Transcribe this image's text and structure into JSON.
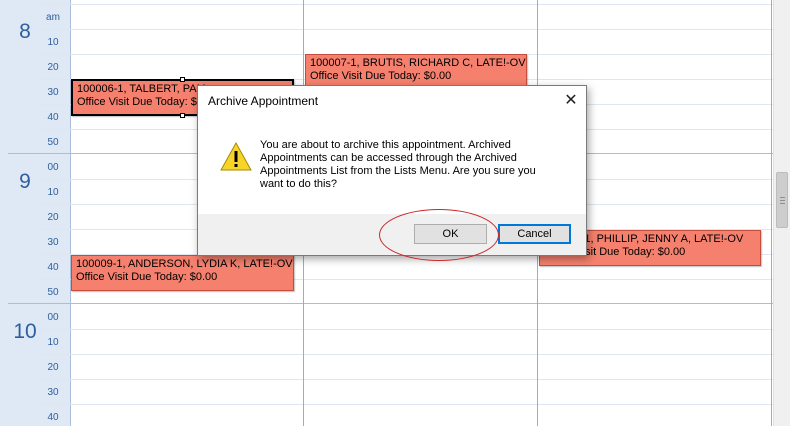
{
  "calendar": {
    "hours": [
      {
        "label": "8",
        "minutes": [
          "am",
          "10",
          "20",
          "30",
          "40",
          "50"
        ]
      },
      {
        "label": "9",
        "minutes": [
          "00",
          "10",
          "20",
          "30",
          "40",
          "50"
        ]
      },
      {
        "label": "10",
        "minutes": [
          "00",
          "10",
          "20",
          "30",
          "40"
        ]
      }
    ],
    "appointments": [
      {
        "line1": "100006-1, TALBERT, PAM",
        "line2": "Office Visit Due Today: $0.00"
      },
      {
        "line1": "100007-1, BRUTIS, RICHARD C, LATE!-OV",
        "line2": "Office Visit Due Today: $0.00"
      },
      {
        "line1": "100009-1, ANDERSON, LYDIA K, LATE!-OV",
        "line2": "Office Visit Due Today: $0.00"
      },
      {
        "line1": "100008-1, PHILLIP, JENNY A, LATE!-OV",
        "line2": "Office Visit Due Today: $0.00"
      }
    ],
    "colors": {
      "appointment": "#f5806e",
      "appointment_border": "#c34e3b",
      "day_divider": "#e3a629",
      "time_text": "#2d5f9e"
    }
  },
  "dialog": {
    "title": "Archive Appointment",
    "close_glyph": "✕",
    "icon": "warning-icon",
    "message": "You are about to archive this appointment.  Archived\nAppointments can be accessed through the Archived\nAppointments List from the Lists Menu.  Are you sure you\nwant to do this?",
    "ok_label": "OK",
    "cancel_label": "Cancel",
    "annotation_color": "#cc2a2a"
  }
}
